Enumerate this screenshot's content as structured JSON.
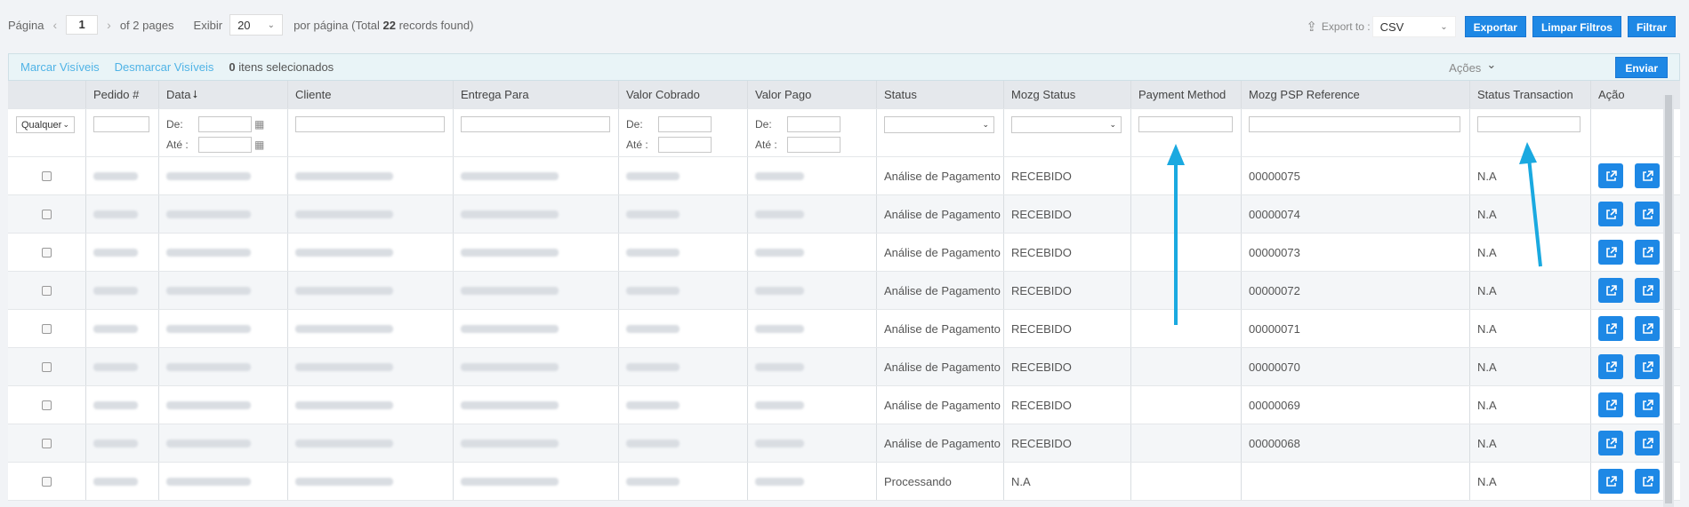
{
  "pager": {
    "page_label": "Página",
    "current_page": "1",
    "of_pages": "of 2 pages",
    "show_label": "Exibir",
    "per_page": "20",
    "per_page_suffix_pre": "por página (Total ",
    "total": "22",
    "per_page_suffix_post": " records found)"
  },
  "export": {
    "label": "Export to :",
    "format": "CSV",
    "export_button": "Exportar",
    "clear_filters_button": "Limpar Filtros",
    "filter_button": "Filtrar"
  },
  "massaction": {
    "select_visible": "Marcar Visíveis",
    "unselect_visible": "Desmarcar Visíveis",
    "selected_count": "0",
    "selected_text": "itens selecionados",
    "actions_label": "Ações",
    "submit_button": "Enviar"
  },
  "columns": {
    "order": "Pedido #",
    "date": "Data",
    "client": "Cliente",
    "ship_to": "Entrega Para",
    "charged": "Valor Cobrado",
    "paid": "Valor Pago",
    "status": "Status",
    "mozg_status": "Mozg Status",
    "payment_method": "Payment Method",
    "psp_ref": "Mozg PSP Reference",
    "status_transaction": "Status Transaction",
    "action": "Ação"
  },
  "filters": {
    "any": "Qualquer",
    "from": "De:",
    "to": "Até :"
  },
  "rows": [
    {
      "status": "Análise de Pagamento",
      "mozg_status": "RECEBIDO",
      "psp_ref": "00000075",
      "status_transaction": "N.A"
    },
    {
      "status": "Análise de Pagamento",
      "mozg_status": "RECEBIDO",
      "psp_ref": "00000074",
      "status_transaction": "N.A"
    },
    {
      "status": "Análise de Pagamento",
      "mozg_status": "RECEBIDO",
      "psp_ref": "00000073",
      "status_transaction": "N.A"
    },
    {
      "status": "Análise de Pagamento",
      "mozg_status": "RECEBIDO",
      "psp_ref": "00000072",
      "status_transaction": "N.A"
    },
    {
      "status": "Análise de Pagamento",
      "mozg_status": "RECEBIDO",
      "psp_ref": "00000071",
      "status_transaction": "N.A"
    },
    {
      "status": "Análise de Pagamento",
      "mozg_status": "RECEBIDO",
      "psp_ref": "00000070",
      "status_transaction": "N.A"
    },
    {
      "status": "Análise de Pagamento",
      "mozg_status": "RECEBIDO",
      "psp_ref": "00000069",
      "status_transaction": "N.A"
    },
    {
      "status": "Análise de Pagamento",
      "mozg_status": "RECEBIDO",
      "psp_ref": "00000068",
      "status_transaction": "N.A"
    },
    {
      "status": "Processando",
      "mozg_status": "N.A",
      "psp_ref": "",
      "status_transaction": "N.A"
    }
  ],
  "colors": {
    "accent": "#1e88e5",
    "link": "#4fb3e6",
    "annotation_arrow": "#1aa9e0"
  }
}
